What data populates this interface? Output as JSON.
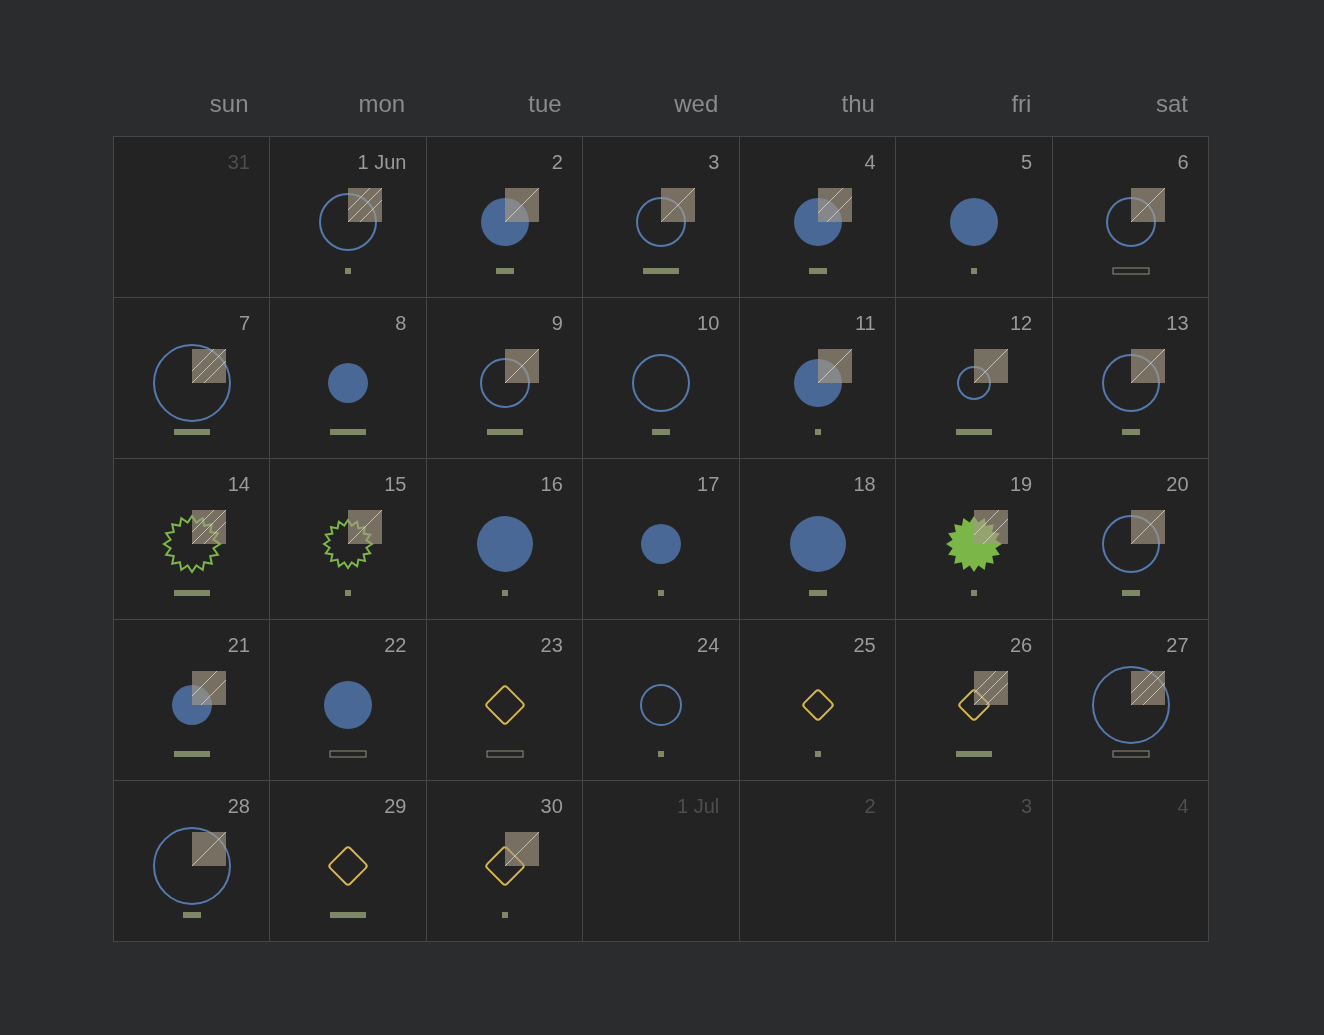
{
  "weekdays": [
    "sun",
    "mon",
    "tue",
    "wed",
    "thu",
    "fri",
    "sat"
  ],
  "weeks": [
    {
      "days": [
        {
          "label": "31",
          "outside": true
        },
        {
          "label": "1 Jun",
          "outside": false,
          "marker": {
            "kind": "ring",
            "size": {
              "kind": "large"
            }
          },
          "square": {
            "kind": "dense"
          },
          "bar": {
            "kind": "solid",
            "length": {
              "kind": "short"
            }
          }
        },
        {
          "label": "2",
          "outside": false,
          "marker": {
            "kind": "disc",
            "size": {
              "kind": "medium"
            }
          },
          "square": {
            "kind": "single"
          },
          "bar": {
            "kind": "solid",
            "length": {
              "kind": "middle"
            }
          }
        },
        {
          "label": "3",
          "outside": false,
          "marker": {
            "kind": "ring",
            "size": {
              "kind": "medium"
            }
          },
          "square": {
            "kind": "single"
          },
          "bar": {
            "kind": "solid",
            "length": {
              "kind": "long"
            }
          }
        },
        {
          "label": "4",
          "outside": false,
          "marker": {
            "kind": "disc",
            "size": {
              "kind": "medium"
            }
          },
          "square": {
            "kind": "double"
          },
          "bar": {
            "kind": "solid",
            "length": {
              "kind": "middle"
            }
          }
        },
        {
          "label": "5",
          "outside": false,
          "marker": {
            "kind": "disc",
            "size": {
              "kind": "medium"
            }
          },
          "bar": {
            "kind": "solid",
            "length": {
              "kind": "short"
            }
          }
        },
        {
          "label": "6",
          "outside": false,
          "marker": {
            "kind": "ring",
            "size": {
              "kind": "medium"
            }
          },
          "square": {
            "kind": "single"
          },
          "bar": {
            "kind": "outline",
            "length": {
              "kind": "long"
            }
          }
        }
      ]
    },
    {
      "days": [
        {
          "label": "7",
          "outside": false,
          "marker": {
            "kind": "ring",
            "size": {
              "kind": "huge"
            }
          },
          "square": {
            "kind": "dense"
          },
          "bar": {
            "kind": "solid",
            "length": {
              "kind": "long"
            }
          }
        },
        {
          "label": "8",
          "outside": false,
          "marker": {
            "kind": "disc",
            "size": {
              "kind": "small"
            }
          },
          "bar": {
            "kind": "solid",
            "length": {
              "kind": "long"
            }
          }
        },
        {
          "label": "9",
          "outside": false,
          "marker": {
            "kind": "ring",
            "size": {
              "kind": "medium"
            }
          },
          "square": {
            "kind": "single"
          },
          "bar": {
            "kind": "solid",
            "length": {
              "kind": "long"
            }
          }
        },
        {
          "label": "10",
          "outside": false,
          "marker": {
            "kind": "ring",
            "size": {
              "kind": "large"
            }
          },
          "bar": {
            "kind": "solid",
            "length": {
              "kind": "middle"
            }
          }
        },
        {
          "label": "11",
          "outside": false,
          "marker": {
            "kind": "disc",
            "size": {
              "kind": "medium"
            }
          },
          "square": {
            "kind": "single"
          },
          "bar": {
            "kind": "solid",
            "length": {
              "kind": "short"
            }
          }
        },
        {
          "label": "12",
          "outside": false,
          "marker": {
            "kind": "ring",
            "size": {
              "kind": "tiny"
            }
          },
          "square": {
            "kind": "single"
          },
          "bar": {
            "kind": "solid",
            "length": {
              "kind": "long"
            }
          }
        },
        {
          "label": "13",
          "outside": false,
          "marker": {
            "kind": "ring",
            "size": {
              "kind": "large"
            }
          },
          "square": {
            "kind": "single"
          },
          "bar": {
            "kind": "solid",
            "length": {
              "kind": "middle"
            }
          }
        }
      ]
    },
    {
      "days": [
        {
          "label": "14",
          "outside": false,
          "marker": {
            "kind": "burst-ring",
            "size": {
              "kind": "large"
            }
          },
          "square": {
            "kind": "dense"
          },
          "bar": {
            "kind": "solid",
            "length": {
              "kind": "long"
            }
          }
        },
        {
          "label": "15",
          "outside": false,
          "marker": {
            "kind": "burst-ring",
            "size": {
              "kind": "medium"
            }
          },
          "square": {
            "kind": "single"
          },
          "bar": {
            "kind": "solid",
            "length": {
              "kind": "short"
            }
          }
        },
        {
          "label": "16",
          "outside": false,
          "marker": {
            "kind": "disc",
            "size": {
              "kind": "large"
            }
          },
          "bar": {
            "kind": "solid",
            "length": {
              "kind": "short"
            }
          }
        },
        {
          "label": "17",
          "outside": false,
          "marker": {
            "kind": "disc",
            "size": {
              "kind": "small"
            }
          },
          "bar": {
            "kind": "solid",
            "length": {
              "kind": "short"
            }
          }
        },
        {
          "label": "18",
          "outside": false,
          "marker": {
            "kind": "disc",
            "size": {
              "kind": "large"
            }
          },
          "bar": {
            "kind": "solid",
            "length": {
              "kind": "middle"
            }
          }
        },
        {
          "label": "19",
          "outside": false,
          "marker": {
            "kind": "burst-solid",
            "size": {
              "kind": "large"
            }
          },
          "square": {
            "kind": "double"
          },
          "bar": {
            "kind": "solid",
            "length": {
              "kind": "short"
            }
          }
        },
        {
          "label": "20",
          "outside": false,
          "marker": {
            "kind": "ring",
            "size": {
              "kind": "large"
            }
          },
          "square": {
            "kind": "single"
          },
          "bar": {
            "kind": "solid",
            "length": {
              "kind": "middle"
            }
          }
        }
      ]
    },
    {
      "days": [
        {
          "label": "21",
          "outside": false,
          "marker": {
            "kind": "disc",
            "size": {
              "kind": "small"
            }
          },
          "square": {
            "kind": "double"
          },
          "bar": {
            "kind": "solid",
            "length": {
              "kind": "long"
            }
          }
        },
        {
          "label": "22",
          "outside": false,
          "marker": {
            "kind": "disc",
            "size": {
              "kind": "medium"
            }
          },
          "bar": {
            "kind": "outline",
            "length": {
              "kind": "long"
            }
          }
        },
        {
          "label": "23",
          "outside": false,
          "marker": {
            "kind": "diamond",
            "size": {
              "kind": "small"
            }
          },
          "bar": {
            "kind": "outline",
            "length": {
              "kind": "long"
            }
          }
        },
        {
          "label": "24",
          "outside": false,
          "marker": {
            "kind": "ring",
            "size": {
              "kind": "small"
            }
          },
          "bar": {
            "kind": "solid",
            "length": {
              "kind": "short"
            }
          }
        },
        {
          "label": "25",
          "outside": false,
          "marker": {
            "kind": "diamond",
            "size": {
              "kind": "tiny"
            }
          },
          "bar": {
            "kind": "solid",
            "length": {
              "kind": "short"
            }
          }
        },
        {
          "label": "26",
          "outside": false,
          "marker": {
            "kind": "diamond",
            "size": {
              "kind": "tiny"
            }
          },
          "square": {
            "kind": "dense"
          },
          "bar": {
            "kind": "solid",
            "length": {
              "kind": "long"
            }
          }
        },
        {
          "label": "27",
          "outside": false,
          "marker": {
            "kind": "ring",
            "size": {
              "kind": "huge"
            }
          },
          "square": {
            "kind": "dense"
          },
          "bar": {
            "kind": "outline",
            "length": {
              "kind": "long"
            }
          }
        }
      ]
    },
    {
      "days": [
        {
          "label": "28",
          "outside": false,
          "marker": {
            "kind": "ring",
            "size": {
              "kind": "huge"
            }
          },
          "square": {
            "kind": "single"
          },
          "bar": {
            "kind": "solid",
            "length": {
              "kind": "middle"
            }
          }
        },
        {
          "label": "29",
          "outside": false,
          "marker": {
            "kind": "diamond",
            "size": {
              "kind": "small"
            }
          },
          "bar": {
            "kind": "solid",
            "length": {
              "kind": "long"
            }
          }
        },
        {
          "label": "30",
          "outside": false,
          "marker": {
            "kind": "diamond",
            "size": {
              "kind": "small"
            }
          },
          "square": {
            "kind": "single"
          },
          "bar": {
            "kind": "solid",
            "length": {
              "kind": "short"
            }
          }
        },
        {
          "label": "1 Jul",
          "outside": true
        },
        {
          "label": "2",
          "outside": true
        },
        {
          "label": "3",
          "outside": true
        },
        {
          "label": "4",
          "outside": true
        }
      ]
    }
  ]
}
